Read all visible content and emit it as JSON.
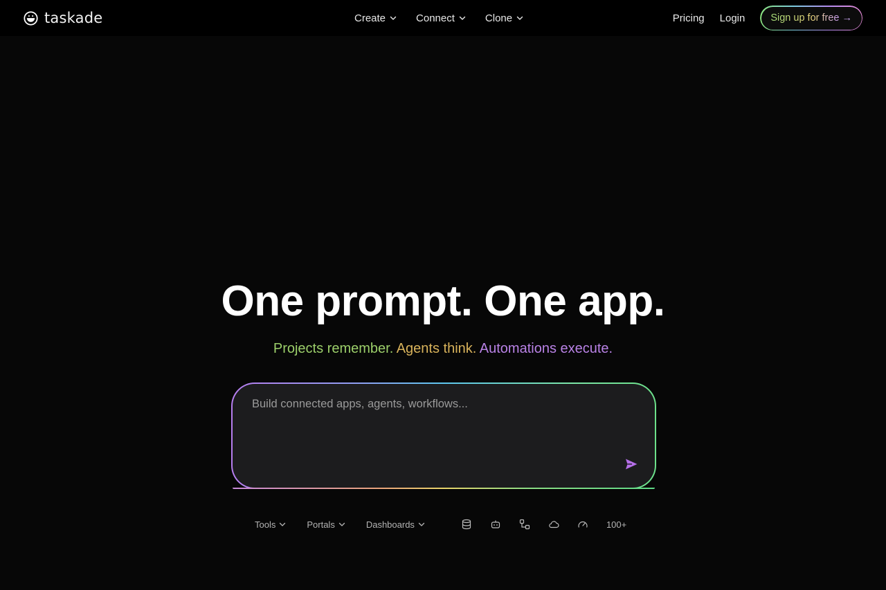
{
  "header": {
    "brand": "taskade",
    "nav": [
      {
        "label": "Create"
      },
      {
        "label": "Connect"
      },
      {
        "label": "Clone"
      }
    ],
    "pricing": "Pricing",
    "login": "Login",
    "signup": "Sign up for free",
    "signup_arrow": "→"
  },
  "hero": {
    "title": "One prompt. One app.",
    "sub_a": "Projects remember.",
    "sub_b": "Agents think.",
    "sub_c": "Automations execute."
  },
  "prompt": {
    "placeholder": "Build connected apps, agents, workflows..."
  },
  "bottom": {
    "tools": "Tools",
    "portals": "Portals",
    "dashboards": "Dashboards",
    "icons": [
      "database-icon",
      "bot-icon",
      "workflow-icon",
      "cloud-icon",
      "gauge-icon"
    ],
    "more": "100+"
  },
  "colors": {
    "background": "#070707",
    "sub_green": "#9ccf6a",
    "sub_gold": "#d9b35b",
    "sub_purple": "#b982e6",
    "send": "#b56fe8"
  }
}
